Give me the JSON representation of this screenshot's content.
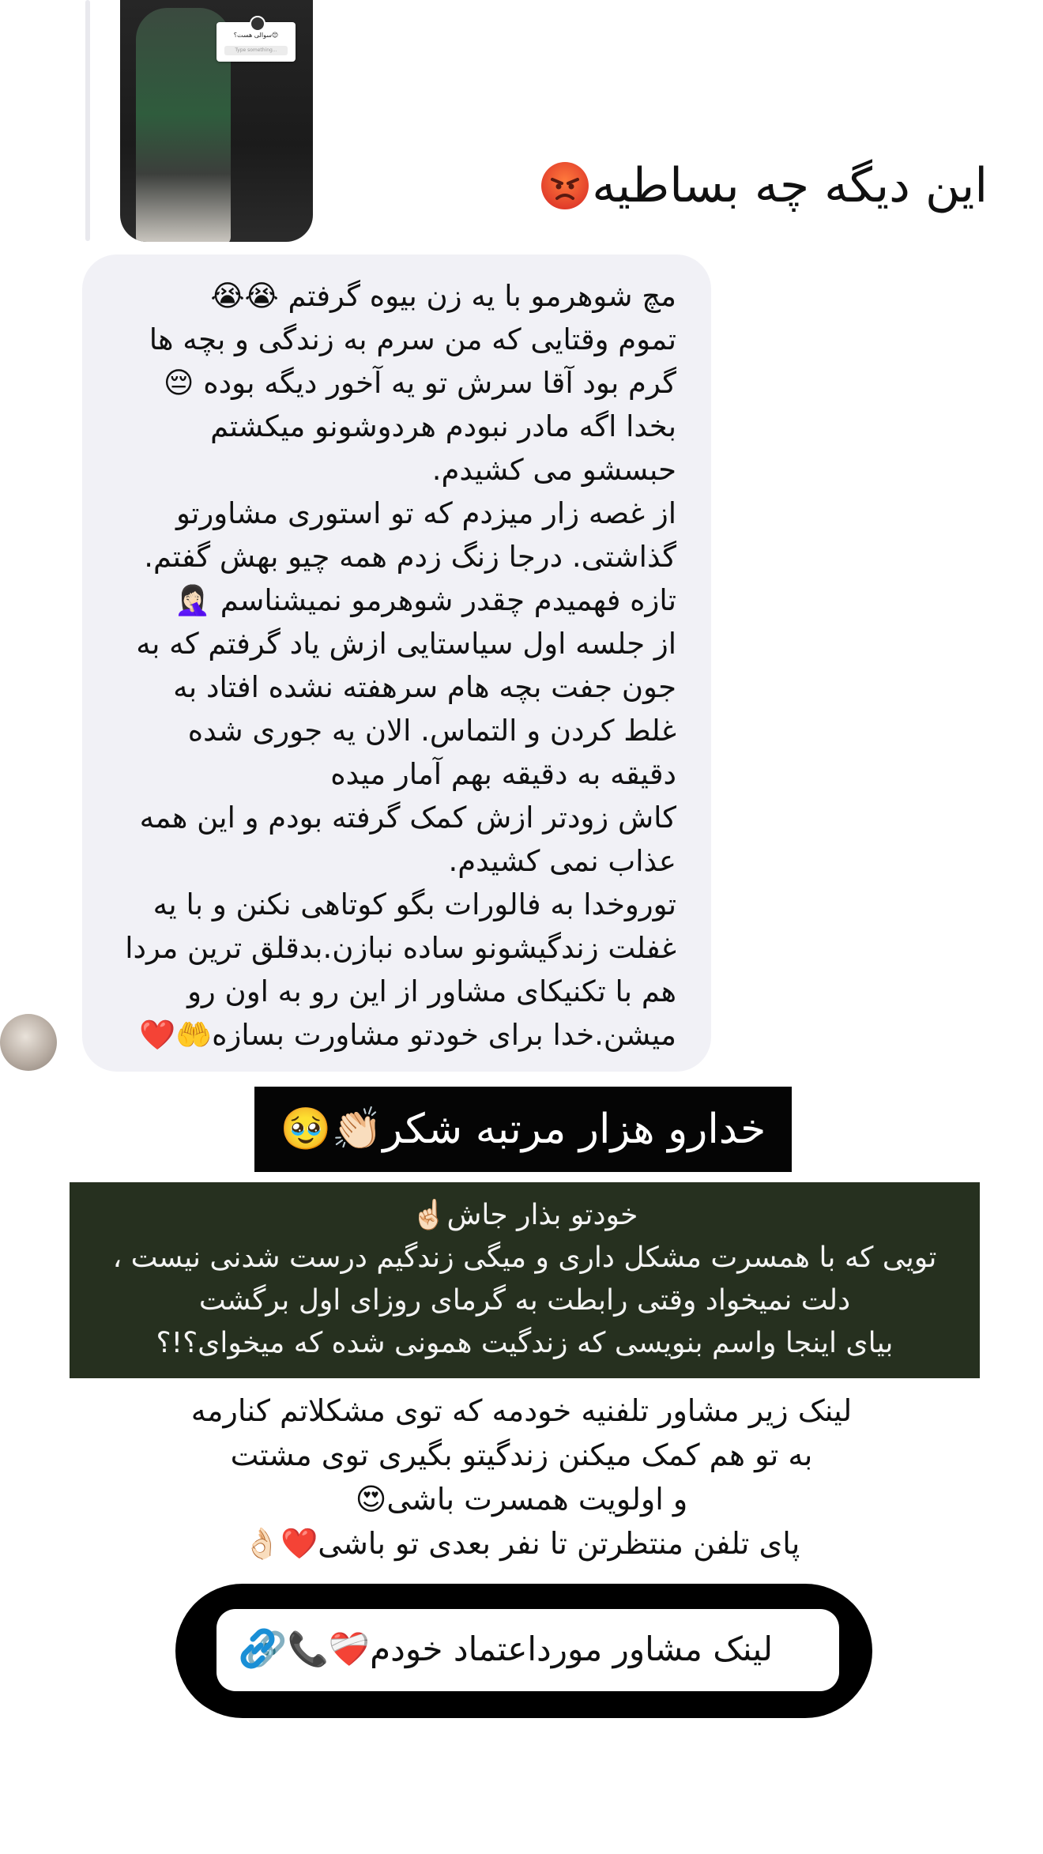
{
  "story": {
    "card_text": "سوالی هست؟😊",
    "card_placeholder": "Type something..."
  },
  "story_reply_caption": "این دیگه چه بساطیه",
  "message": {
    "lines": [
      "مچ شوهرمو با یه زن بیوه گرفتم 😭😭",
      "تموم وقتایی که من سرم به زندگی و بچه ها",
      "گرم بود آقا سرش تو یه آخور دیگه بوده 😔",
      "بخدا اگه مادر نبودم هردوشونو میکشتم",
      "حبسشو می کشیدم.",
      "از غصه زار میزدم که تو استوری مشاورتو",
      "گذاشتی. درجا زنگ زدم همه چیو بهش گفتم.",
      "تازه فهمیدم چقدر شوهرمو نمیشناسم 🤦🏻‍♀️",
      "از جلسه اول سیاستایی ازش یاد گرفتم که به",
      "جون جفت بچه هام سرهفته نشده افتاد به",
      "غلط کردن و التماس. الان یه جوری شده",
      "دقیقه به دقیقه بهم آمار میده",
      "کاش زودتر ازش کمک گرفته بودم و این همه",
      "عذاب نمی کشیدم.",
      "توروخدا به فالورات بگو کوتاهی نکنن  و با یه",
      "غفلت زندگیشونو ساده نبازن.بدقلق ترین مردا",
      "هم با تکنیکای مشاور از این رو به اون رو",
      "میشن.خدا برای خودتو مشاورت بسازه🤲❤️"
    ]
  },
  "thanks_banner": "خدارو هزار مرتبه شکر👏🏻🥹",
  "promo_box": {
    "lines": [
      "خودتو بذار جاش☝🏻",
      "تویی که با همسرت مشکل داری و میگی زندگیم درست شدنی نیست ،",
      "دلت نمیخواد وقتی رابطت به گرمای روزای اول برگشت",
      "بیای اینجا واسم بنویسی که زندگیت همونی شده که میخوای؟!؟"
    ]
  },
  "link_intro": {
    "lines": [
      "لینک زیر مشاور تلفنیه خودمه که توی مشکلاتم کنارمه",
      "به تو هم کمک میکنن زندگیتو بگیری توی مشتت",
      "و اولویت همسرت باشی😍",
      "پای تلفن منتظرتن تا نفر بعدی تو باشی❤️👌🏻"
    ]
  },
  "link_button": {
    "label": "لینک مشاور مورداعتماد خودم❤️‍🩹📞🔗"
  },
  "colors": {
    "bubble": "#f1f1f6",
    "banner": "#050505",
    "promo_bg": "#26301f",
    "link_icon": "#1a8fd6"
  }
}
